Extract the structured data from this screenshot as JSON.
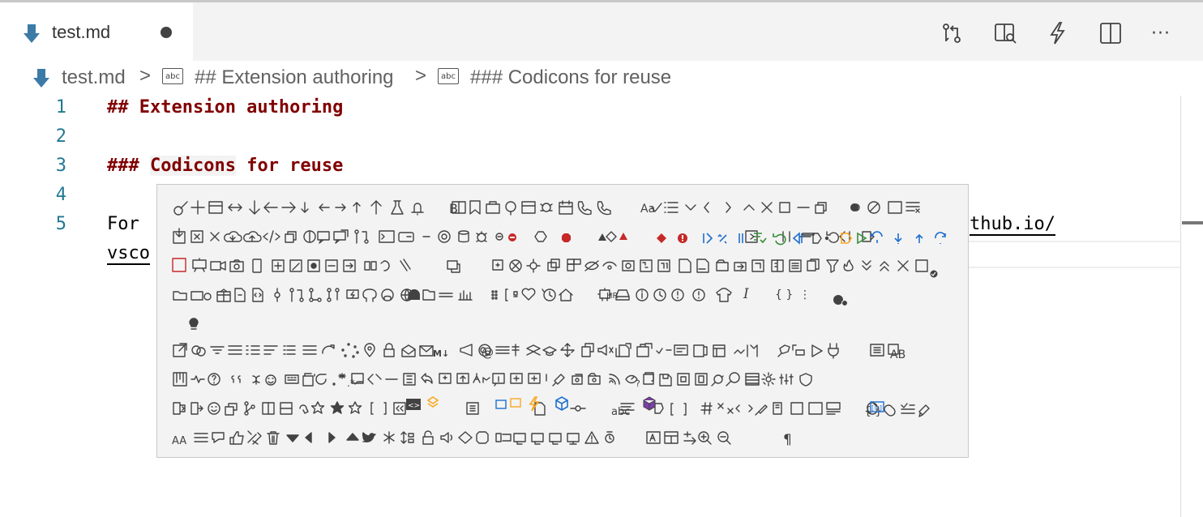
{
  "tab": {
    "title": "test.md",
    "file_icon": "markdown-download-icon",
    "dirty_indicator": "dot"
  },
  "editor_actions": [
    {
      "name": "source-control-compare-icon"
    },
    {
      "name": "open-preview-icon"
    },
    {
      "name": "lightning-icon"
    },
    {
      "name": "split-editor-icon"
    },
    {
      "name": "more-actions-icon",
      "glyph": "···"
    }
  ],
  "breadcrumb": {
    "file": "test.md",
    "separator": ">",
    "item1": "## Extension authoring",
    "item2": "### Codicons for reuse",
    "symbol_icon_text": "abc"
  },
  "lines": [
    {
      "num": "1",
      "text": "## Extension authoring"
    },
    {
      "num": "2",
      "text": ""
    },
    {
      "num": "3",
      "text_hash": "### ",
      "text_word1": "Codicons",
      "text_rest": " for reuse"
    },
    {
      "num": "4",
      "text": ""
    },
    {
      "num": "5",
      "text_start": "For",
      "text_end": "thub.io/",
      "wrap_start": "vsco"
    }
  ],
  "hover": {
    "description": "Codicon preview panel",
    "text_glyphs": [
      "B",
      "Aa",
      "AB",
      "M↓",
      "abc",
      "HR",
      "I",
      "{ }",
      "¶",
      "AA",
      "#"
    ]
  },
  "colors": {
    "heading": "#800000",
    "line_number": "#237893",
    "accent_blue": "#1f6fd0",
    "tab_bg": "#f3f3f3"
  }
}
